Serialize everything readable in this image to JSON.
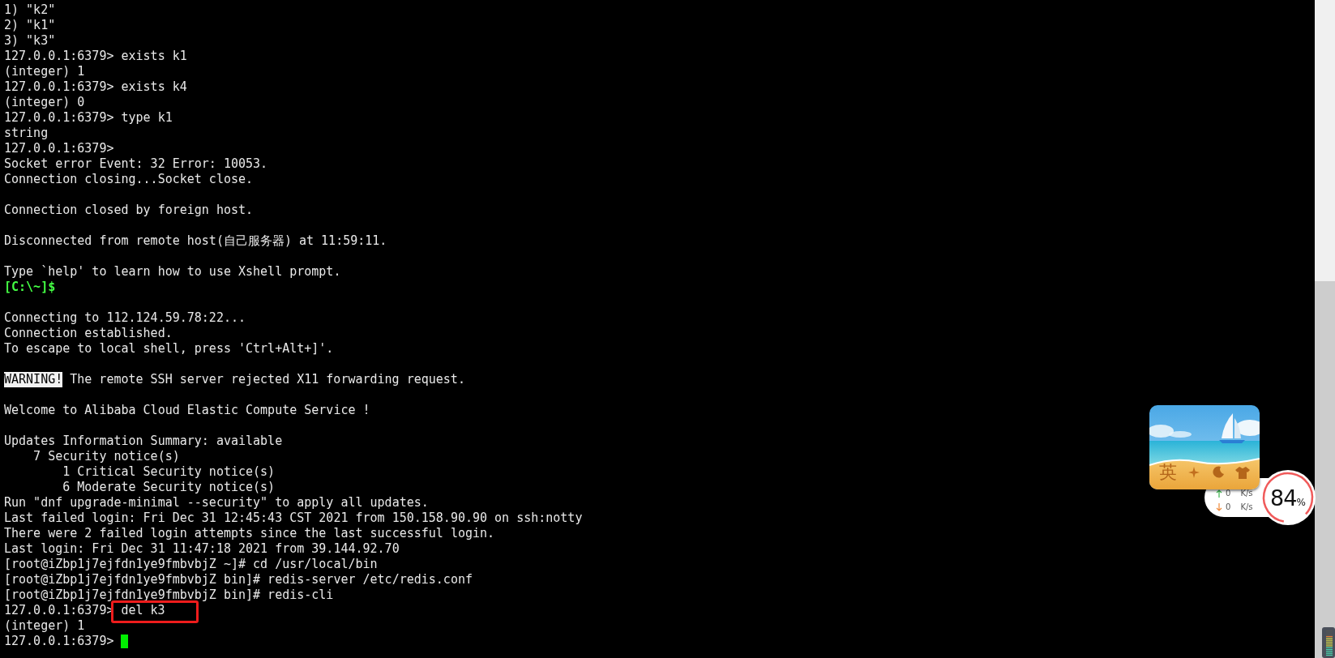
{
  "terminal": {
    "lines": [
      {
        "kind": "plain",
        "text": "1) \"k2\""
      },
      {
        "kind": "plain",
        "text": "2) \"k1\""
      },
      {
        "kind": "plain",
        "text": "3) \"k3\""
      },
      {
        "kind": "plain",
        "text": "127.0.0.1:6379> exists k1"
      },
      {
        "kind": "plain",
        "text": "(integer) 1"
      },
      {
        "kind": "plain",
        "text": "127.0.0.1:6379> exists k4"
      },
      {
        "kind": "plain",
        "text": "(integer) 0"
      },
      {
        "kind": "plain",
        "text": "127.0.0.1:6379> type k1"
      },
      {
        "kind": "plain",
        "text": "string"
      },
      {
        "kind": "plain",
        "text": "127.0.0.1:6379>"
      },
      {
        "kind": "plain",
        "text": "Socket error Event: 32 Error: 10053."
      },
      {
        "kind": "plain",
        "text": "Connection closing...Socket close."
      },
      {
        "kind": "blank"
      },
      {
        "kind": "plain",
        "text": "Connection closed by foreign host."
      },
      {
        "kind": "blank"
      },
      {
        "kind": "plain",
        "text": "Disconnected from remote host(自己服务器) at 11:59:11."
      },
      {
        "kind": "blank"
      },
      {
        "kind": "plain",
        "text": "Type `help' to learn how to use Xshell prompt."
      },
      {
        "kind": "local_prompt",
        "text": "[C:\\~]$"
      },
      {
        "kind": "blank"
      },
      {
        "kind": "plain",
        "text": "Connecting to 112.124.59.78:22..."
      },
      {
        "kind": "plain",
        "text": "Connection established."
      },
      {
        "kind": "plain",
        "text": "To escape to local shell, press 'Ctrl+Alt+]'."
      },
      {
        "kind": "blank"
      },
      {
        "kind": "warning",
        "badge": "WARNING!",
        "text": "The remote SSH server rejected X11 forwarding request."
      },
      {
        "kind": "blank"
      },
      {
        "kind": "plain",
        "text": "Welcome to Alibaba Cloud Elastic Compute Service !"
      },
      {
        "kind": "blank"
      },
      {
        "kind": "plain",
        "text": "Updates Information Summary: available"
      },
      {
        "kind": "plain",
        "text": "    7 Security notice(s)"
      },
      {
        "kind": "plain",
        "text": "        1 Critical Security notice(s)"
      },
      {
        "kind": "plain",
        "text": "        6 Moderate Security notice(s)"
      },
      {
        "kind": "plain",
        "text": "Run \"dnf upgrade-minimal --security\" to apply all updates."
      },
      {
        "kind": "plain",
        "text": "Last failed login: Fri Dec 31 12:45:43 CST 2021 from 150.158.90.90 on ssh:notty"
      },
      {
        "kind": "plain",
        "text": "There were 2 failed login attempts since the last successful login."
      },
      {
        "kind": "plain",
        "text": "Last login: Fri Dec 31 11:47:18 2021 from 39.144.92.70"
      },
      {
        "kind": "plain",
        "text": "[root@iZbp1j7ejfdn1ye9fmbvbjZ ~]# cd /usr/local/bin"
      },
      {
        "kind": "plain",
        "text": "[root@iZbp1j7ejfdn1ye9fmbvbjZ bin]# redis-server /etc/redis.conf"
      },
      {
        "kind": "plain",
        "text": "[root@iZbp1j7ejfdn1ye9fmbvbjZ bin]# redis-cli"
      },
      {
        "kind": "annotated",
        "prompt": "127.0.0.1:6379>",
        "text": "del k3"
      },
      {
        "kind": "plain",
        "text": "(integer) 1"
      },
      {
        "kind": "cursor",
        "text": "127.0.0.1:6379>"
      }
    ]
  },
  "widget": {
    "ime_label": "英",
    "upload": "0",
    "upload_unit": "K/s",
    "download": "0",
    "download_unit": "K/s",
    "usage": "84",
    "usage_unit": "%"
  }
}
